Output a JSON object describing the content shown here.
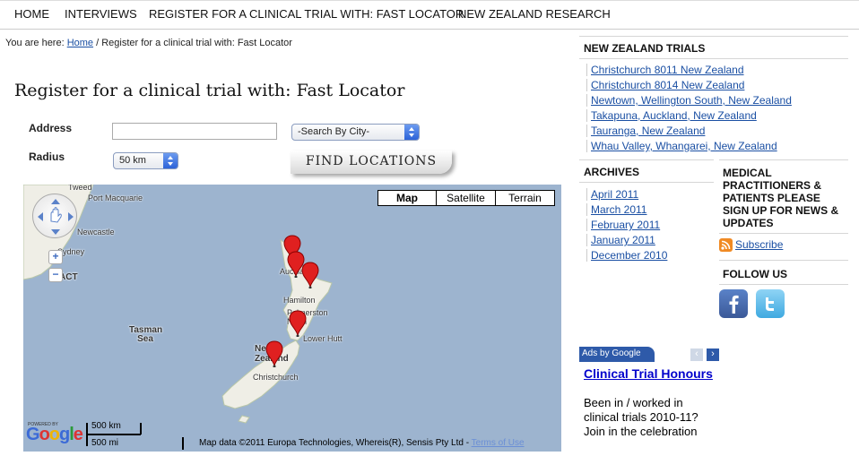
{
  "nav": {
    "items": [
      {
        "label": "HOME"
      },
      {
        "label": "INTERVIEWS"
      },
      {
        "label": "REGISTER FOR A CLINICAL TRIAL WITH: FAST LOCATOR"
      },
      {
        "label": "NEW ZEALAND RESEARCH"
      }
    ]
  },
  "breadcrumb": {
    "prefix": "You are here: ",
    "home": "Home",
    "current": " / Register for a clinical trial with: Fast Locator"
  },
  "page": {
    "title": "Register for a clinical trial with: Fast Locator"
  },
  "form": {
    "address_label": "Address",
    "address_value": "",
    "city_select": "-Search By City-",
    "radius_label": "Radius",
    "radius_select": "50 km",
    "find_button": "FIND LOCATIONS"
  },
  "map": {
    "types": [
      "Map",
      "Satellite",
      "Terrain"
    ],
    "selected_type": "Map",
    "places": [
      "Tweed",
      "Port Macquarie",
      "Newcastle",
      "Sydney",
      "ACT",
      "Tasman Sea",
      "Auckland",
      "Hamilton",
      "Palmerston North",
      "Lower Hutt",
      "New Zealand",
      "Christchurch"
    ],
    "powered_by": "POWERED BY",
    "logo": "Google",
    "scale_km": "500 km",
    "scale_mi": "500 mi",
    "attribution": "Map data ©2011 Europa Technologies, Whereis(R), Sensis Pty Ltd - ",
    "terms": "Terms of Use",
    "marker_count": 5
  },
  "sidebar": {
    "trials_heading": "NEW ZEALAND TRIALS",
    "trials": [
      "Christchurch 8011 New Zealand",
      "Christchurch 8014 New Zealand",
      "Newtown, Wellington South, New Zealand",
      "Takapuna, Auckland, New Zealand",
      "Tauranga, New Zealand",
      "Whau Valley, Whangarei, New Zealand"
    ],
    "archives_heading": "ARCHIVES",
    "archives": [
      "April 2011",
      "March 2011",
      "February 2011",
      "January 2011",
      "December 2010"
    ],
    "medical_heading": "MEDICAL PRACTITIONERS & PATIENTS PLEASE SIGN UP FOR NEWS & UPDATES",
    "subscribe": "Subscribe",
    "follow_heading": "FOLLOW US"
  },
  "ad": {
    "label": "Ads by Google",
    "title": "Clinical Trial Honours",
    "body": "Been in / worked in clinical trials 2010-11? Join in the celebration"
  },
  "colors": {
    "link": "#1a4fa3",
    "ad_tab": "#2e5aa9",
    "map_water": "#9db4cf",
    "marker": "#e02020"
  }
}
